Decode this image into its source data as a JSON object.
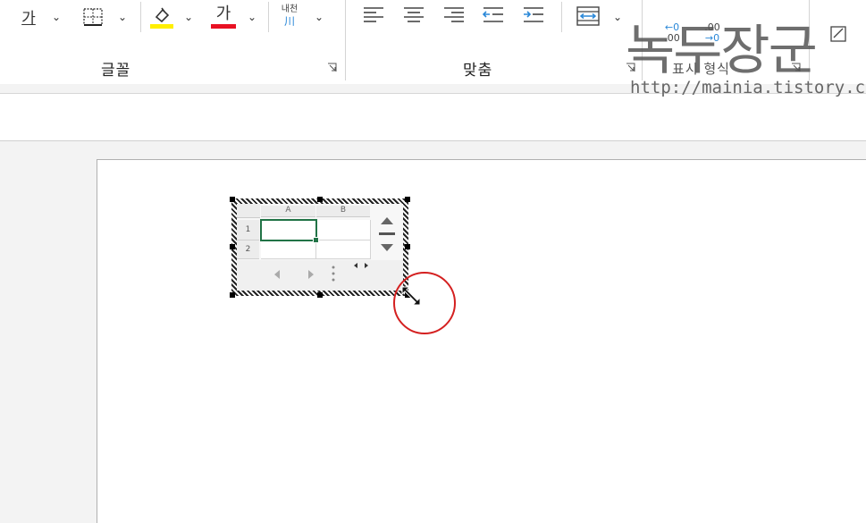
{
  "ribbon": {
    "font_group": {
      "label": "글꼴",
      "border_button": "가",
      "font_color_glyph": "가",
      "phonetic_top": "내천",
      "phonetic_bottom": "川"
    },
    "align_group": {
      "label": "맞춤"
    },
    "number_group": {
      "label": "표시 형식",
      "increase_decimal_top": "←0",
      "increase_decimal_bottom": ".00",
      "decrease_decimal_top": ".00",
      "decrease_decimal_bottom": "→0"
    },
    "colors": {
      "fill_color": "#ffef00",
      "font_color": "#e81123",
      "accent": "#2b88d8"
    }
  },
  "spreadsheet_object": {
    "columns": [
      "A",
      "B"
    ],
    "rows": [
      "1",
      "2"
    ],
    "selected_cell": "A1",
    "selection_color": "#217346"
  },
  "watermark": {
    "title": "녹두장군",
    "url": "http://mainia.tistory.com"
  }
}
